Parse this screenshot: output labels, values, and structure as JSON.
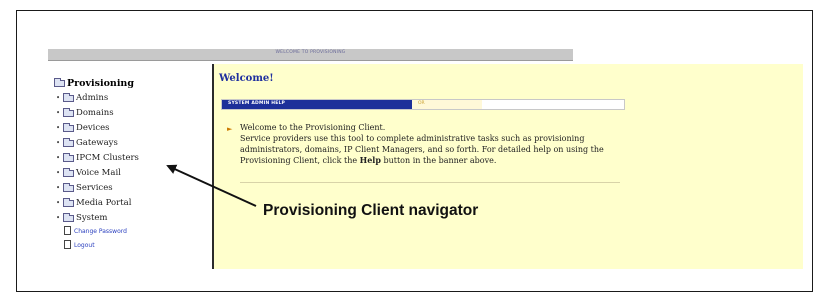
{
  "banner": {
    "title": "WELCOME TO PROVISIONING"
  },
  "nav": {
    "root_label": "Provisioning",
    "items": [
      {
        "label": "Admins"
      },
      {
        "label": "Domains"
      },
      {
        "label": "Devices"
      },
      {
        "label": "Gateways"
      },
      {
        "label": "IPCM Clusters"
      },
      {
        "label": "Voice Mail"
      },
      {
        "label": "Services"
      },
      {
        "label": "Media Portal"
      },
      {
        "label": "System"
      }
    ],
    "links": [
      {
        "label": "Change Password"
      },
      {
        "label": "Logout"
      }
    ]
  },
  "content": {
    "heading": "Welcome!",
    "help_tab": "SYSTEM ADMIN HELP",
    "help_mid": "OR",
    "line1": "Welcome to the Provisioning Client.",
    "line2": "Service providers use this tool to complete administrative tasks such as provisioning",
    "line3": "administrators, domains, IP Client Managers, and so forth. For detailed help on using the",
    "line4_pre": "Provisioning Client, click the ",
    "line4_bold": "Help",
    "line4_post": " button in the banner above."
  },
  "annotation": {
    "caption": "Provisioning Client navigator"
  },
  "colors": {
    "content_bg": "#ffffcc",
    "help_tab": "#1d2f9a",
    "heading": "#1f2f9f",
    "link": "#2a3fbf"
  }
}
